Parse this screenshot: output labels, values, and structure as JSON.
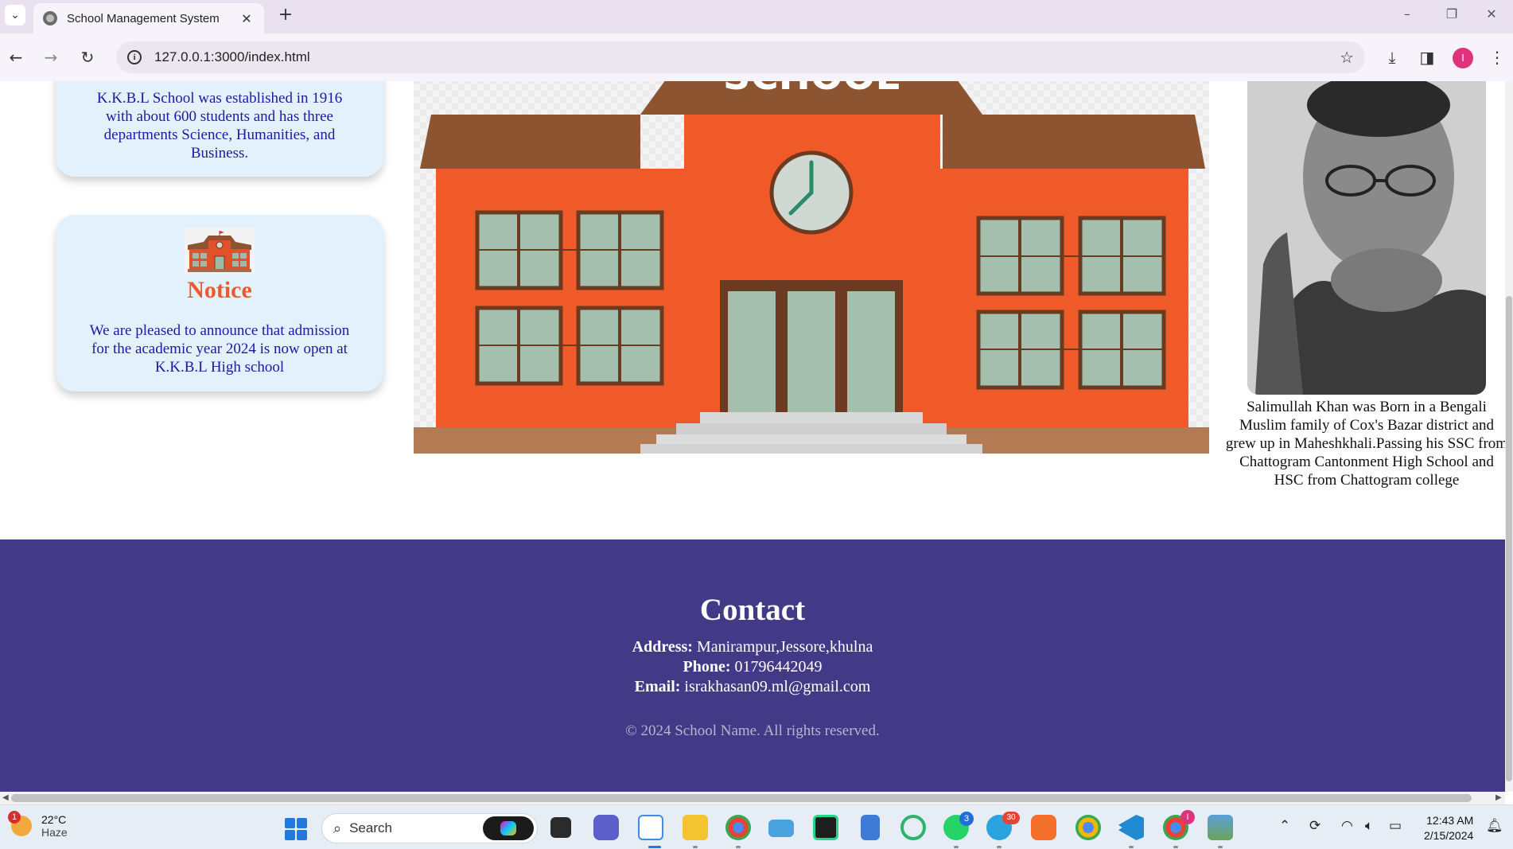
{
  "browser": {
    "tab_title": "School Management System",
    "url": "127.0.0.1:3000/index.html",
    "profile_initial": "I"
  },
  "page": {
    "about": {
      "text": "K.K.B.L School was established in 1916 with about 600 students and has three departments Science, Humanities, and Business."
    },
    "notice": {
      "title": "Notice",
      "text": "We are pleased to announce that admission for the academic year 2024 is now open at K.K.B.L High school"
    },
    "hero": {
      "sign_text": "SCHOOL"
    },
    "headmaster": {
      "bio_lines": [
        "Salimullah Khan was Born in a Bengali",
        "Muslim family of Cox's Bazar district and",
        "grew up in Maheshkhali.Passing his SSC from",
        "Chattogram Cantonment High School and",
        "HSC from Chattogram college"
      ]
    },
    "footer": {
      "heading": "Contact",
      "address_label": "Address:",
      "address_value": " Manirampur,Jessore,khulna",
      "phone_label": "Phone:",
      "phone_value": " 01796442049",
      "email_label": "Email:",
      "email_value": " israkhasan09.ml@gmail.com",
      "copyright": "© 2024 School Name. All rights reserved."
    }
  },
  "taskbar": {
    "weather_temp": "22°C",
    "weather_desc": "Haze",
    "weather_badge": "1",
    "search_label": "Search",
    "time": "12:43 AM",
    "date": "2/15/2024",
    "whatsapp_badge": "3",
    "telegram_badge": "30",
    "chrome_badge": "I"
  },
  "colors": {
    "footer_bg": "#423a87",
    "card_bg": "#e3f1fc",
    "card_text": "#1a1aa6",
    "notice_title": "#ec5a2b",
    "building_orange": "#f05a28",
    "roof_brown": "#8c5430"
  }
}
